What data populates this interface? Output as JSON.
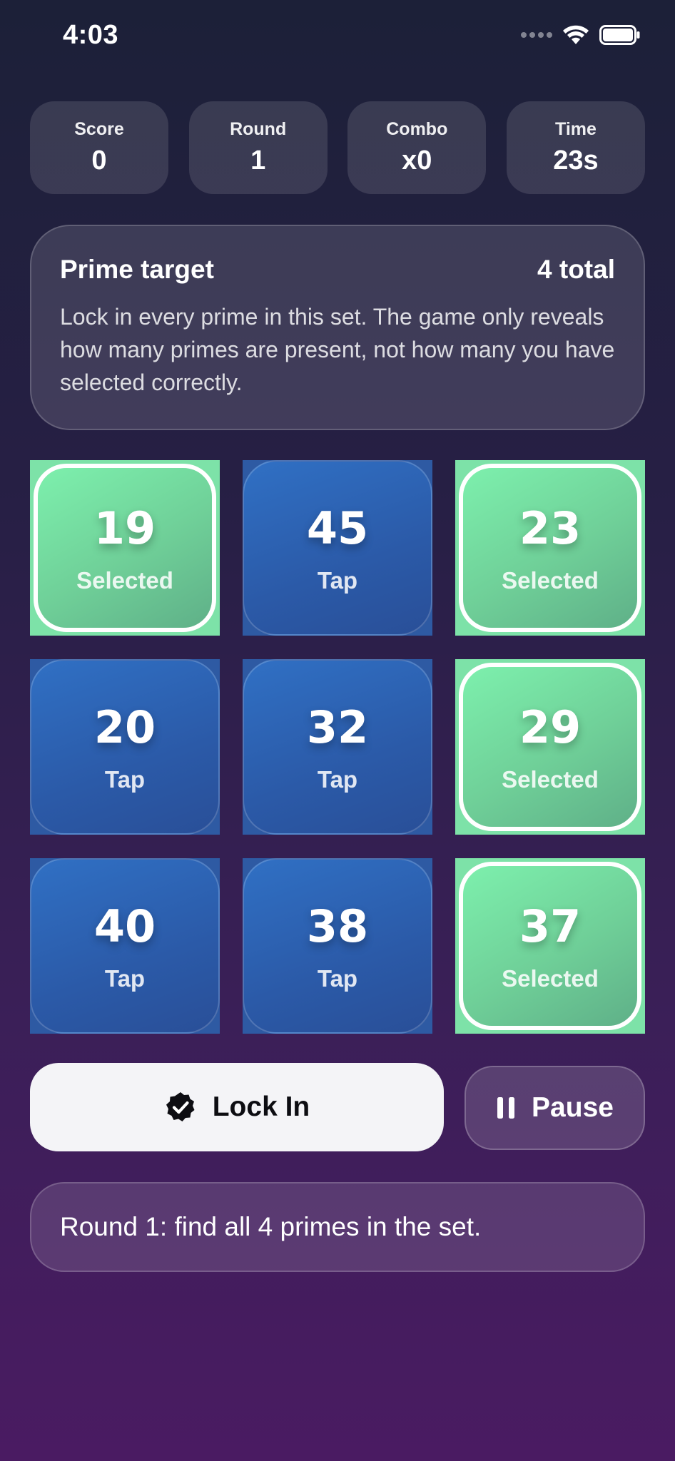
{
  "status_bar": {
    "time": "4:03",
    "icons": [
      "signal-dots-icon",
      "wifi-icon",
      "battery-icon"
    ]
  },
  "stats": [
    {
      "label": "Score",
      "value": "0"
    },
    {
      "label": "Round",
      "value": "1"
    },
    {
      "label": "Combo",
      "value": "x0"
    },
    {
      "label": "Time",
      "value": "23s"
    }
  ],
  "info": {
    "title": "Prime target",
    "total": "4 total",
    "description": "Lock in every prime in this set. The game only reveals how many primes are present, not how many you have selected correctly."
  },
  "tiles": [
    {
      "number": "19",
      "label": "Selected",
      "state": "selected"
    },
    {
      "number": "45",
      "label": "Tap",
      "state": "idle"
    },
    {
      "number": "23",
      "label": "Selected",
      "state": "selected"
    },
    {
      "number": "20",
      "label": "Tap",
      "state": "idle"
    },
    {
      "number": "32",
      "label": "Tap",
      "state": "idle"
    },
    {
      "number": "29",
      "label": "Selected",
      "state": "selected"
    },
    {
      "number": "40",
      "label": "Tap",
      "state": "idle"
    },
    {
      "number": "38",
      "label": "Tap",
      "state": "idle"
    },
    {
      "number": "37",
      "label": "Selected",
      "state": "selected"
    }
  ],
  "actions": {
    "lock_in_label": "Lock In",
    "lock_in_icon": "verified-check-icon",
    "pause_label": "Pause",
    "pause_icon": "pause-icon"
  },
  "message": "Round 1: find all 4 primes in the set.",
  "colors": {
    "selected_tile": "#7de2a8",
    "idle_tile": "#2e5aa3",
    "primary_button": "#f4f4f7"
  }
}
